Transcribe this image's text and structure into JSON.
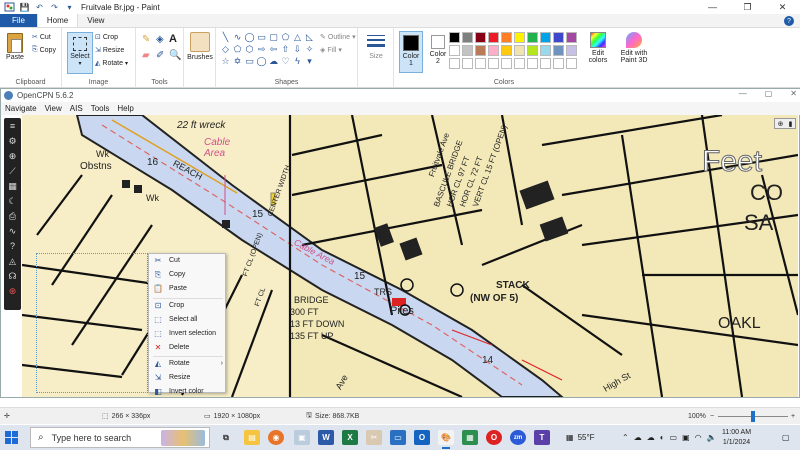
{
  "window": {
    "title": "Fruitvale Br.jpg - Paint",
    "minimize": "—",
    "maximize": "❐",
    "close": "✕"
  },
  "ribbon_tabs": [
    "File",
    "Home",
    "View"
  ],
  "ribbon": {
    "clipboard": {
      "label": "Clipboard",
      "paste": "Paste",
      "cut": "Cut",
      "copy": "Copy"
    },
    "image": {
      "label": "Image",
      "select": "Select",
      "crop": "Crop",
      "resize": "Resize",
      "rotate": "Rotate"
    },
    "tools": {
      "label": "Tools"
    },
    "brushes": {
      "label": "Brushes"
    },
    "shapes": {
      "label": "Shapes",
      "outline": "Outline",
      "fill": "Fill"
    },
    "size": {
      "label": "Size"
    },
    "colors": {
      "label": "Colors",
      "color1": "Color 1",
      "color2": "Color 2",
      "edit_colors": "Edit colors",
      "edit_paint3d": "Edit with Paint 3D",
      "color1_hex": "#000000",
      "color2_hex": "#ffffff"
    }
  },
  "palette": [
    "#000000",
    "#7f7f7f",
    "#880015",
    "#ed1c24",
    "#ff7f27",
    "#fff200",
    "#22b14c",
    "#00a2e8",
    "#3f48cc",
    "#a349a4",
    "#ffffff",
    "#c3c3c3",
    "#b97a57",
    "#ffaec9",
    "#ffc90e",
    "#efe4b0",
    "#b5e61d",
    "#99d9ea",
    "#7092be",
    "#c8bfe7",
    "#ffffff",
    "#ffffff",
    "#ffffff",
    "#ffffff",
    "#ffffff",
    "#ffffff",
    "#ffffff",
    "#ffffff",
    "#ffffff",
    "#ffffff"
  ],
  "opencpn": {
    "title": "OpenCPN 5.6.2",
    "menu": [
      "Navigate",
      "View",
      "AIS",
      "Tools",
      "Help"
    ]
  },
  "chart_labels": {
    "wreck": "22 ft wreck",
    "cable_area": "Cable Area",
    "cable_area2": "Cable Area",
    "obstns": "Obstns",
    "wk": "Wk",
    "reach": "REACH",
    "depth16": "16",
    "depth15": "15",
    "depth15b": "15",
    "depth14": "14",
    "stack": "STACK",
    "stack_sub": "(NW OF 5)",
    "bascule": "BASCULE BRIDGE",
    "hor_cl": "HOR CL 97 FT",
    "hor_cl2": "HOR CL 72 FT",
    "vert_cl": "VERT CL 15 FT (OPEN)",
    "bridge": "BRIDGE",
    "bridge_ft": "300 FT",
    "ft_down": "13 FT DOWN",
    "ft_up": "135 FT UP",
    "piles": "Piles",
    "trs": "TRS",
    "fruitvale_ave": "Fruitvale Ave",
    "oakl": "OAKL",
    "feet": "Feet",
    "co": "CO",
    "sa": "SA",
    "high_st": "High St",
    "ave": "Ave",
    "center_width": "CENTER WIDTH",
    "ft_open": "FT CL (OPEN)",
    "ft_cl": "FT CL"
  },
  "context_menu": [
    {
      "label": "Cut",
      "icon": "scissors-icon",
      "glyph": "✂"
    },
    {
      "label": "Copy",
      "icon": "copy-icon",
      "glyph": "⎘"
    },
    {
      "label": "Paste",
      "icon": "paste-icon",
      "glyph": "📋"
    },
    {
      "label": "Crop",
      "icon": "crop-icon",
      "glyph": "⊡"
    },
    {
      "label": "Select all",
      "icon": "select-all-icon",
      "glyph": "⬚"
    },
    {
      "label": "Invert selection",
      "icon": "invert-selection-icon",
      "glyph": "⬚"
    },
    {
      "label": "Delete",
      "icon": "delete-icon",
      "glyph": "✕"
    },
    {
      "label": "Rotate",
      "icon": "rotate-icon",
      "glyph": "◭"
    },
    {
      "label": "Resize",
      "icon": "resize-icon",
      "glyph": "⇲"
    },
    {
      "label": "Invert color",
      "icon": "invert-color-icon",
      "glyph": "◧"
    }
  ],
  "status": {
    "selection_size": "266 × 336px",
    "image_size": "1920 × 1080px",
    "file_size": "Size: 868.7KB",
    "zoom": "100%"
  },
  "taskbar": {
    "search_placeholder": "Type here to search",
    "weather": "55°F",
    "time": "11:00 AM",
    "date": "1/1/2024"
  }
}
